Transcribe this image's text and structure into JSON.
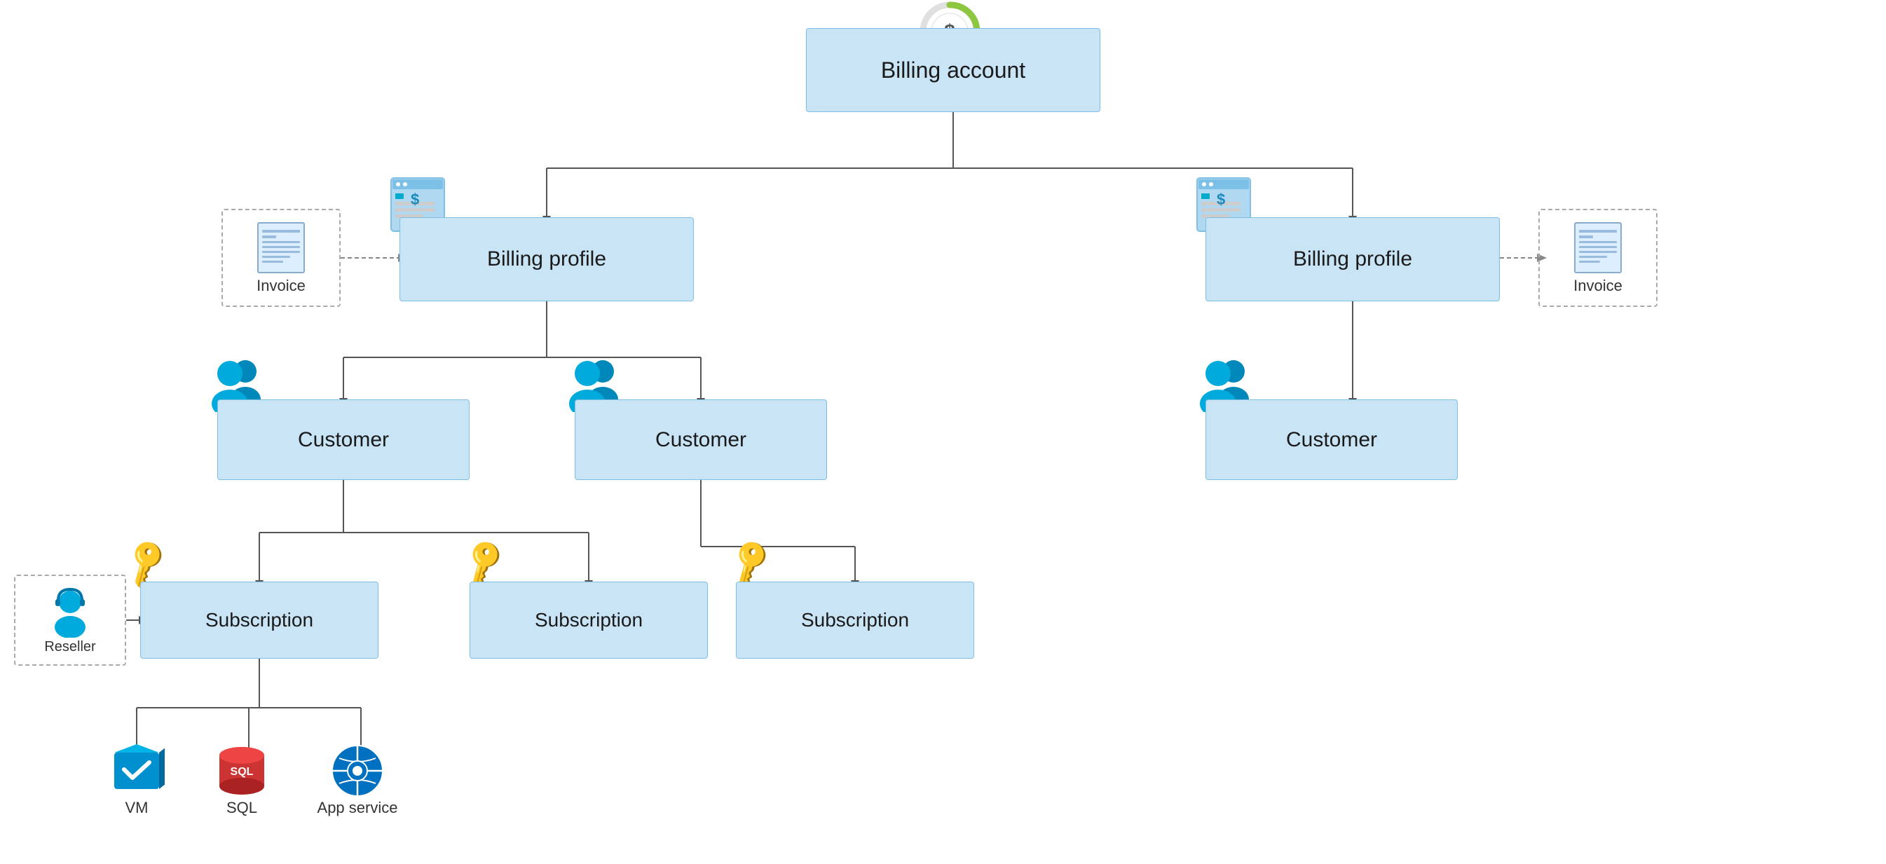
{
  "nodes": {
    "billing_account": {
      "label": "Billing account"
    },
    "billing_profile_left": {
      "label": "Billing profile"
    },
    "billing_profile_right": {
      "label": "Billing profile"
    },
    "customer_1": {
      "label": "Customer"
    },
    "customer_2": {
      "label": "Customer"
    },
    "customer_3": {
      "label": "Customer"
    },
    "subscription_1": {
      "label": "Subscription"
    },
    "subscription_2": {
      "label": "Subscription"
    },
    "subscription_3": {
      "label": "Subscription"
    },
    "invoice_left": {
      "label": "Invoice"
    },
    "invoice_right": {
      "label": "Invoice"
    },
    "reseller": {
      "label": "Reseller"
    },
    "vm": {
      "label": "VM"
    },
    "sql": {
      "label": "SQL"
    },
    "app_service": {
      "label": "App service"
    }
  },
  "colors": {
    "node_bg": "#c9e4f5",
    "node_border": "#7cc0e8",
    "line": "#555",
    "dashed_border": "#aaa",
    "key": "#e8b800",
    "people": "#00aacc",
    "green": "#8dc63f",
    "billing_blue": "#00aacc"
  }
}
